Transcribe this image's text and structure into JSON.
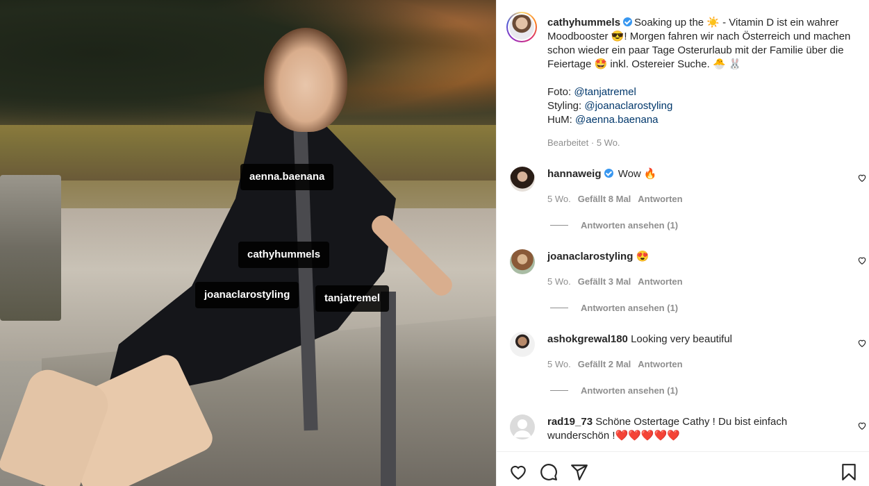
{
  "photo": {
    "tags": [
      {
        "name": "tag-aenna",
        "label": "aenna.baenana"
      },
      {
        "name": "tag-cathy",
        "label": "cathyhummels"
      },
      {
        "name": "tag-joana",
        "label": "joanaclarostyling"
      },
      {
        "name": "tag-tanja",
        "label": "tanjatremel"
      }
    ]
  },
  "post": {
    "author": "cathyhummels",
    "caption_line1": "Soaking up the ☀️ - Vitamin D ist ein wahrer Moodbooster 😎! Morgen fahren wir nach Österreich und machen schon wieder ein paar Tage Osterurlaub mit der Familie über die Feiertage 🤩 inkl. Ostereier Suche. 🐣 🐰",
    "credit_foto_label": "Foto: ",
    "credit_foto": "@tanjatremel",
    "credit_styling_label": "Styling: ",
    "credit_styling": "@joanaclarostyling",
    "credit_hum_label": "HuM: ",
    "credit_hum": "@aenna.baenana",
    "meta": "Bearbeitet · 5 Wo."
  },
  "comments": [
    {
      "user": "hannaweig",
      "verified": true,
      "text": "Wow 🔥",
      "time": "5 Wo.",
      "likes": "Gefällt 8 Mal",
      "reply": "Antworten",
      "view_replies": "Antworten ansehen (1)"
    },
    {
      "user": "joanaclarostyling",
      "verified": false,
      "text": "😍",
      "time": "5 Wo.",
      "likes": "Gefällt 3 Mal",
      "reply": "Antworten",
      "view_replies": "Antworten ansehen (1)"
    },
    {
      "user": "ashokgrewal180",
      "verified": false,
      "text": "Looking very beautiful",
      "time": "5 Wo.",
      "likes": "Gefällt 2 Mal",
      "reply": "Antworten",
      "view_replies": "Antworten ansehen (1)"
    },
    {
      "user": "rad19_73",
      "verified": false,
      "text": "Schöne Ostertage Cathy ! Du bist einfach wunderschön !❤️❤️❤️❤️❤️"
    }
  ],
  "actions": {
    "icons": [
      "heart-icon",
      "comment-icon",
      "share-icon",
      "bookmark-icon"
    ]
  },
  "colors": {
    "mention": "#00376b",
    "verified": "#3897f0",
    "muted": "#8e8e8e",
    "text": "#262626"
  }
}
